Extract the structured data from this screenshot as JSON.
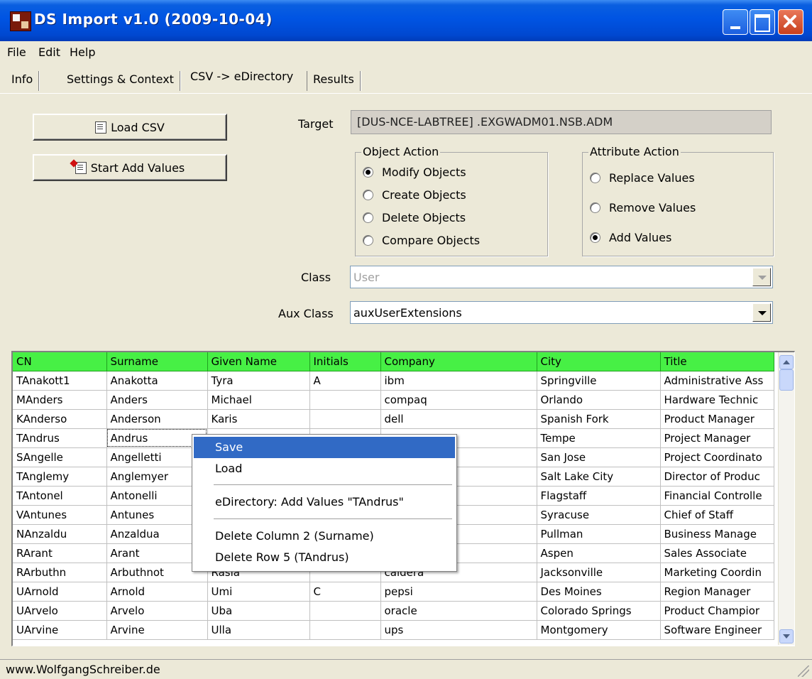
{
  "window": {
    "title": "DS Import v1.0 (2009-10-04)"
  },
  "menu": [
    "File",
    "Edit",
    "Help"
  ],
  "tabs": [
    "Info",
    "Settings & Context",
    "CSV -> eDirectory",
    "Results"
  ],
  "buttons": {
    "load_csv": "Load CSV",
    "start": "Start Add Values"
  },
  "target": {
    "label": "Target",
    "value": "[DUS-NCE-LABTREE] .EXGWADM01.NSB.ADM"
  },
  "object_action": {
    "title": "Object Action",
    "options": [
      "Modify Objects",
      "Create Objects",
      "Delete Objects",
      "Compare Objects"
    ],
    "selected": "Modify Objects"
  },
  "attribute_action": {
    "title": "Attribute Action",
    "options": [
      "Replace Values",
      "Remove Values",
      "Add Values"
    ],
    "selected": "Add Values"
  },
  "class": {
    "label": "Class",
    "value": "User"
  },
  "aux_class": {
    "label": "Aux Class",
    "value": "auxUserExtensions"
  },
  "grid": {
    "header_color": "#47f045",
    "columns": [
      "CN",
      "Surname",
      "Given Name",
      "Initials",
      "Company",
      "City",
      "Title"
    ],
    "rows": [
      [
        "TAnakott1",
        "Anakotta",
        "Tyra",
        "A",
        "ibm",
        "Springville",
        "Administrative Ass"
      ],
      [
        "MAnders",
        "Anders",
        "Michael",
        "",
        "compaq",
        "Orlando",
        "Hardware Technic"
      ],
      [
        "KAnderso",
        "Anderson",
        "Karis",
        "",
        "dell",
        "Spanish Fork",
        "Product Manager"
      ],
      [
        "TAndrus",
        "Andrus",
        "",
        "",
        "",
        "Tempe",
        "Project Manager"
      ],
      [
        "SAngelle",
        "Angelletti",
        "",
        "",
        "",
        "San Jose",
        "Project Coordinato"
      ],
      [
        "TAnglemy",
        "Anglemyer",
        "",
        "",
        "",
        "Salt Lake City",
        "Director of Produc"
      ],
      [
        "TAntonel",
        "Antonelli",
        "",
        "",
        "",
        "Flagstaff",
        "Financial Controlle"
      ],
      [
        "VAntunes",
        "Antunes",
        "",
        "",
        "",
        "Syracuse",
        "Chief of Staff"
      ],
      [
        "NAnzaldu",
        "Anzaldua",
        "",
        "",
        "",
        "Pullman",
        "Business Manage"
      ],
      [
        "RArant",
        "Arant",
        "",
        "",
        "",
        "Aspen",
        "Sales Associate"
      ],
      [
        "RArbuthn",
        "Arbuthnot",
        "Rasia",
        "",
        "caldera",
        "Jacksonville",
        "Marketing Coordin"
      ],
      [
        "UArnold",
        "Arnold",
        "Umi",
        "C",
        "pepsi",
        "Des Moines",
        "Region Manager"
      ],
      [
        "UArvelo",
        "Arvelo",
        "Uba",
        "",
        "oracle",
        "Colorado Springs",
        "Product Champior"
      ],
      [
        "UArvine",
        "Arvine",
        "Ulla",
        "",
        "ups",
        "Montgomery",
        "Software Engineer"
      ]
    ]
  },
  "context_menu": {
    "items": [
      "Save",
      "Load",
      "eDirectory: Add Values \"TAndrus\"",
      "Delete Column 2 (Surname)",
      "Delete Row 5 (TAndrus)"
    ],
    "highlighted": "Save"
  },
  "status": "www.WolfgangSchreiber.de"
}
